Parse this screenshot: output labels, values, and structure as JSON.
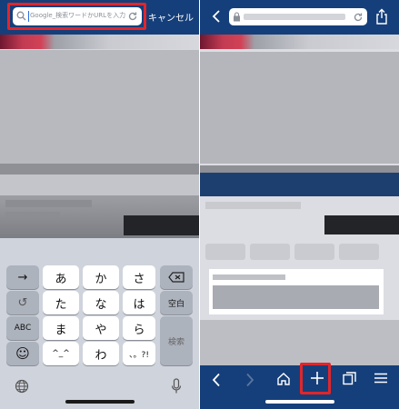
{
  "left": {
    "search": {
      "placeholder": "Google_検索ワードかURLを入力"
    },
    "cancel_label": "キャンセル",
    "keyboard": {
      "keys": {
        "arrow": "→",
        "a": "あ",
        "ka": "か",
        "sa": "さ",
        "undo": "↺",
        "ta": "た",
        "na": "な",
        "ha": "は",
        "space": "空白",
        "abc": "ABC",
        "ma": "ま",
        "ya": "や",
        "ra": "ら",
        "emoji": "☺",
        "kaomoji": "^_^",
        "wa": "わ",
        "punct": "、。?!",
        "search": "検索"
      }
    }
  },
  "right": {
    "toolbar_icons": [
      "back-icon",
      "forward-icon",
      "home-icon",
      "new-tab-plus-icon",
      "tabs-icon",
      "menu-icon"
    ]
  },
  "colors": {
    "navy": "#153f7a",
    "highlight": "#e0262b",
    "blur_gray": "#a8abb2"
  }
}
